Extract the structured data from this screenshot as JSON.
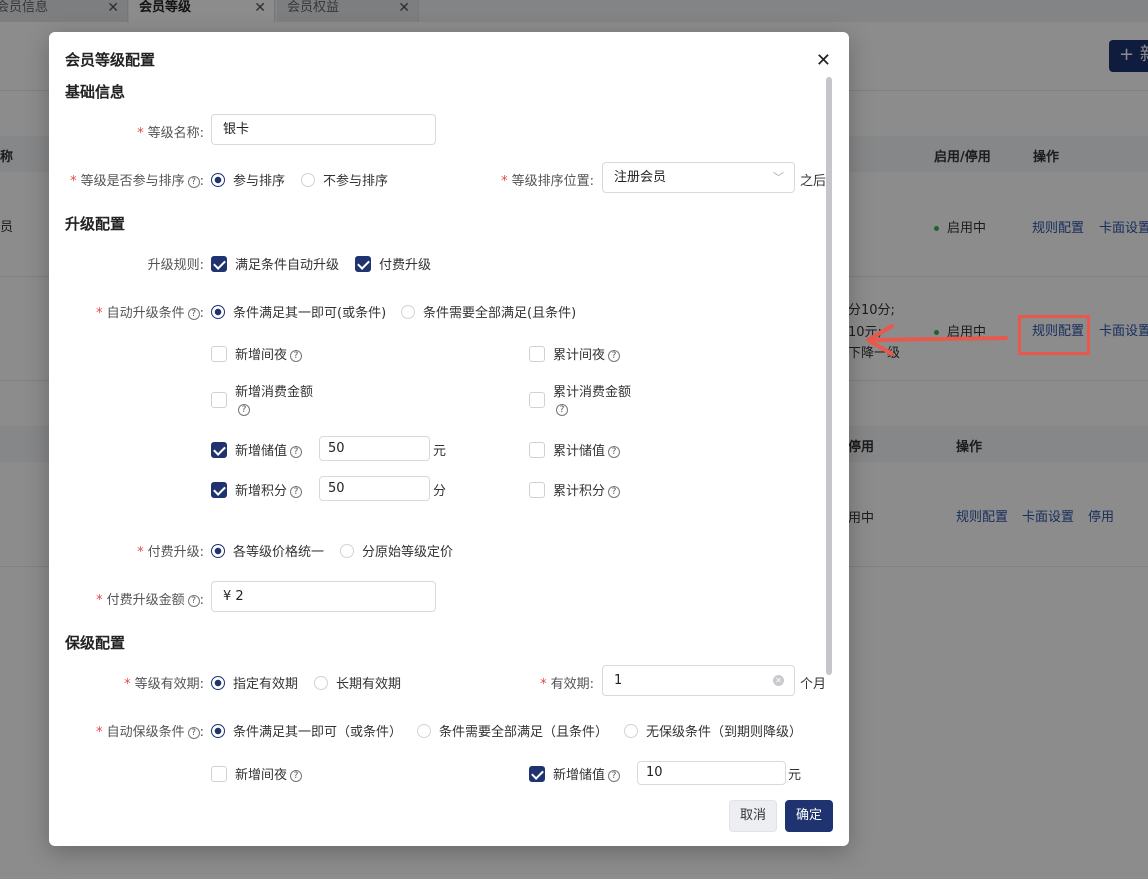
{
  "tabs": [
    {
      "label": "会员信息"
    },
    {
      "label": "会员等级"
    },
    {
      "label": "会员权益"
    }
  ],
  "background": {
    "new_button": "+ 新",
    "table1": {
      "headers": [
        "称",
        "启用/停用",
        "操作"
      ],
      "row1": {
        "name": "员",
        "status": "启用中",
        "rule_link": "规则配置",
        "card_link": "卡面设置"
      },
      "row2": {
        "desc1": "分10分;",
        "desc2": "10元;",
        "desc3": "下降一级",
        "status": "启用中",
        "rule_link": "规则配置",
        "card_link": "卡面设置"
      }
    },
    "table2": {
      "headers": [
        "停用",
        "操作"
      ],
      "row1": {
        "status": "用中",
        "rule_link": "规则配置",
        "card_link": "卡面设置",
        "disable_link": "停用"
      }
    }
  },
  "dialog": {
    "title": "会员等级配置",
    "close": "✕",
    "basic": {
      "title": "基础信息",
      "name_label": "等级名称:",
      "name_value": "银卡",
      "sort_label": "等级是否参与排序",
      "sort_opt1": "参与排序",
      "sort_opt2": "不参与排序",
      "pos_label": "等级排序位置:",
      "pos_value": "注册会员",
      "pos_suffix": "之后"
    },
    "upgrade": {
      "title": "升级配置",
      "rule_label": "升级规则:",
      "rule_opt1": "满足条件自动升级",
      "rule_opt2": "付费升级",
      "auto_label": "自动升级条件",
      "auto_opt1": "条件满足其一即可(或条件)",
      "auto_opt2": "条件需要全部满足(且条件)",
      "conds": {
        "new_night": "新增间夜",
        "total_night": "累计间夜",
        "new_spend": "新增消费金额",
        "total_spend": "累计消费金额",
        "new_stored": "新增储值",
        "new_stored_value": "50",
        "new_stored_unit": "元",
        "total_stored": "累计储值",
        "new_points": "新增积分",
        "new_points_value": "50",
        "new_points_unit": "分",
        "total_points": "累计积分"
      },
      "pay_label": "付费升级:",
      "pay_opt1": "各等级价格统一",
      "pay_opt2": "分原始等级定价",
      "amount_label": "付费升级金额",
      "amount_value": "¥ 2"
    },
    "retain": {
      "title": "保级配置",
      "valid_label": "等级有效期:",
      "valid_opt1": "指定有效期",
      "valid_opt2": "长期有效期",
      "period_label": "有效期:",
      "period_value": "1",
      "period_unit": "个月",
      "auto_label": "自动保级条件",
      "auto_opt1": "条件满足其一即可（或条件）",
      "auto_opt2": "条件需要全部满足（且条件）",
      "auto_opt3": "无保级条件（到期则降级）",
      "new_night": "新增间夜",
      "new_stored": "新增储值",
      "new_stored_value": "10",
      "new_stored_unit": "元"
    },
    "cancel_label": "取消",
    "ok_label": "确定"
  },
  "colors": {
    "primary": "#1e3370",
    "required": "#e5483c",
    "annotation": "#e8584d",
    "status_green": "#35b35e"
  }
}
